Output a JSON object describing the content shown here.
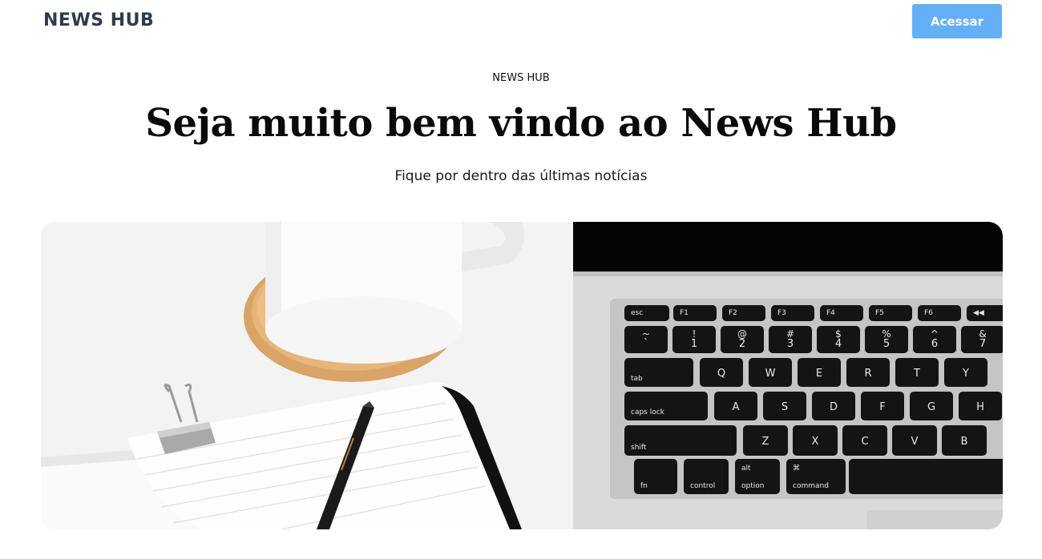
{
  "header": {
    "brand": "NEWS HUB",
    "login_label": "Acessar"
  },
  "hero": {
    "eyebrow": "NEWS HUB",
    "title": "Seja muito bem vindo ao News Hub",
    "subtitle": "Fique por dentro das últimas notícias"
  },
  "colors": {
    "brand": "#2f3b4c",
    "button": "#63b0f8",
    "text": "#0a0a0a"
  },
  "keyboard": {
    "fn_row": [
      "esc",
      "F1",
      "F2",
      "F3",
      "F4",
      "F5",
      "F6",
      "◀◀"
    ],
    "num_row_top": [
      "~",
      "!",
      "@",
      "#",
      "$",
      "%",
      "^",
      "&"
    ],
    "num_row_bottom": [
      "`",
      "1",
      "2",
      "3",
      "4",
      "5",
      "6",
      "7"
    ],
    "row_q": [
      "tab",
      "Q",
      "W",
      "E",
      "R",
      "T",
      "Y"
    ],
    "row_a": [
      "caps lock",
      "A",
      "S",
      "D",
      "F",
      "G",
      "H"
    ],
    "row_z": [
      "shift",
      "Z",
      "X",
      "C",
      "V",
      "B"
    ],
    "row_mod": [
      "fn",
      "control",
      "option",
      "command"
    ],
    "row_mod_sub": [
      "",
      "",
      "alt",
      "⌘"
    ]
  }
}
